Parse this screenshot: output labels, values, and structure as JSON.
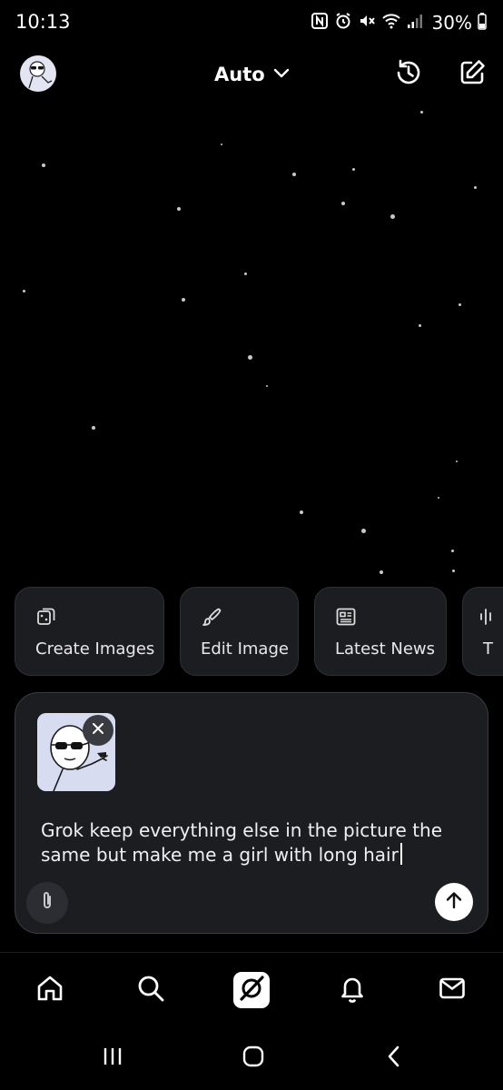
{
  "status_bar": {
    "time": "10:13",
    "battery": "30%",
    "icons": [
      "nfc-icon",
      "alarm-icon",
      "mute-icon",
      "wifi-icon",
      "signal-icon",
      "battery-icon"
    ]
  },
  "header": {
    "model_label": "Auto",
    "icons": [
      "avatar",
      "chevron-down-icon",
      "history-icon",
      "new-chat-icon"
    ]
  },
  "suggestions": [
    {
      "label": "Create Images",
      "icon": "dice-image-icon"
    },
    {
      "label": "Edit Image",
      "icon": "brush-icon"
    },
    {
      "label": "Latest News",
      "icon": "newspaper-icon"
    },
    {
      "label": "T",
      "icon": "voice-wave-icon"
    }
  ],
  "composer": {
    "prompt_text": "Grok keep everything else in the picture the same but make me a girl with long hair",
    "attachment": "sunglasses-stickman-image"
  },
  "bottom_nav": [
    "home-icon",
    "search-icon",
    "grok-icon",
    "notifications-icon",
    "messages-icon"
  ],
  "system_nav": [
    "recents-icon",
    "home-circle-icon",
    "back-icon"
  ],
  "colors": {
    "background": "#000000",
    "card": "#1c1d21",
    "border": "#2e3036",
    "text": "#ffffff"
  }
}
